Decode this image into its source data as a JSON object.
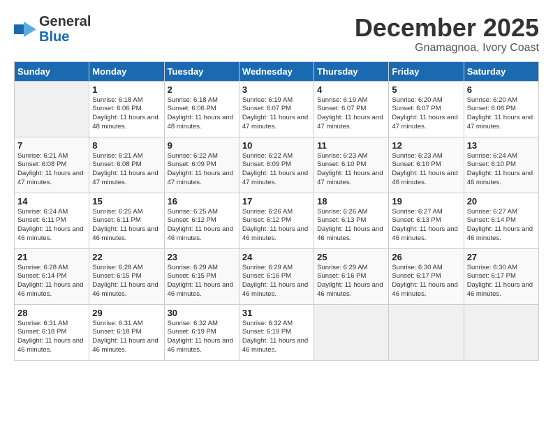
{
  "header": {
    "logo_line1": "General",
    "logo_line2": "Blue",
    "month": "December 2025",
    "location": "Gnamagnoa, Ivory Coast"
  },
  "days_of_week": [
    "Sunday",
    "Monday",
    "Tuesday",
    "Wednesday",
    "Thursday",
    "Friday",
    "Saturday"
  ],
  "weeks": [
    [
      {
        "day": "",
        "sunrise": "",
        "sunset": "",
        "daylight": ""
      },
      {
        "day": "1",
        "sunrise": "Sunrise: 6:18 AM",
        "sunset": "Sunset: 6:06 PM",
        "daylight": "Daylight: 11 hours and 48 minutes."
      },
      {
        "day": "2",
        "sunrise": "Sunrise: 6:18 AM",
        "sunset": "Sunset: 6:06 PM",
        "daylight": "Daylight: 11 hours and 48 minutes."
      },
      {
        "day": "3",
        "sunrise": "Sunrise: 6:19 AM",
        "sunset": "Sunset: 6:07 PM",
        "daylight": "Daylight: 11 hours and 47 minutes."
      },
      {
        "day": "4",
        "sunrise": "Sunrise: 6:19 AM",
        "sunset": "Sunset: 6:07 PM",
        "daylight": "Daylight: 11 hours and 47 minutes."
      },
      {
        "day": "5",
        "sunrise": "Sunrise: 6:20 AM",
        "sunset": "Sunset: 6:07 PM",
        "daylight": "Daylight: 11 hours and 47 minutes."
      },
      {
        "day": "6",
        "sunrise": "Sunrise: 6:20 AM",
        "sunset": "Sunset: 6:08 PM",
        "daylight": "Daylight: 11 hours and 47 minutes."
      }
    ],
    [
      {
        "day": "7",
        "sunrise": "Sunrise: 6:21 AM",
        "sunset": "Sunset: 6:08 PM",
        "daylight": "Daylight: 11 hours and 47 minutes."
      },
      {
        "day": "8",
        "sunrise": "Sunrise: 6:21 AM",
        "sunset": "Sunset: 6:08 PM",
        "daylight": "Daylight: 11 hours and 47 minutes."
      },
      {
        "day": "9",
        "sunrise": "Sunrise: 6:22 AM",
        "sunset": "Sunset: 6:09 PM",
        "daylight": "Daylight: 11 hours and 47 minutes."
      },
      {
        "day": "10",
        "sunrise": "Sunrise: 6:22 AM",
        "sunset": "Sunset: 6:09 PM",
        "daylight": "Daylight: 11 hours and 47 minutes."
      },
      {
        "day": "11",
        "sunrise": "Sunrise: 6:23 AM",
        "sunset": "Sunset: 6:10 PM",
        "daylight": "Daylight: 11 hours and 47 minutes."
      },
      {
        "day": "12",
        "sunrise": "Sunrise: 6:23 AM",
        "sunset": "Sunset: 6:10 PM",
        "daylight": "Daylight: 11 hours and 46 minutes."
      },
      {
        "day": "13",
        "sunrise": "Sunrise: 6:24 AM",
        "sunset": "Sunset: 6:10 PM",
        "daylight": "Daylight: 11 hours and 46 minutes."
      }
    ],
    [
      {
        "day": "14",
        "sunrise": "Sunrise: 6:24 AM",
        "sunset": "Sunset: 6:11 PM",
        "daylight": "Daylight: 11 hours and 46 minutes."
      },
      {
        "day": "15",
        "sunrise": "Sunrise: 6:25 AM",
        "sunset": "Sunset: 6:11 PM",
        "daylight": "Daylight: 11 hours and 46 minutes."
      },
      {
        "day": "16",
        "sunrise": "Sunrise: 6:25 AM",
        "sunset": "Sunset: 6:12 PM",
        "daylight": "Daylight: 11 hours and 46 minutes."
      },
      {
        "day": "17",
        "sunrise": "Sunrise: 6:26 AM",
        "sunset": "Sunset: 6:12 PM",
        "daylight": "Daylight: 11 hours and 46 minutes."
      },
      {
        "day": "18",
        "sunrise": "Sunrise: 6:26 AM",
        "sunset": "Sunset: 6:13 PM",
        "daylight": "Daylight: 11 hours and 46 minutes."
      },
      {
        "day": "19",
        "sunrise": "Sunrise: 6:27 AM",
        "sunset": "Sunset: 6:13 PM",
        "daylight": "Daylight: 11 hours and 46 minutes."
      },
      {
        "day": "20",
        "sunrise": "Sunrise: 6:27 AM",
        "sunset": "Sunset: 6:14 PM",
        "daylight": "Daylight: 11 hours and 46 minutes."
      }
    ],
    [
      {
        "day": "21",
        "sunrise": "Sunrise: 6:28 AM",
        "sunset": "Sunset: 6:14 PM",
        "daylight": "Daylight: 11 hours and 46 minutes."
      },
      {
        "day": "22",
        "sunrise": "Sunrise: 6:28 AM",
        "sunset": "Sunset: 6:15 PM",
        "daylight": "Daylight: 11 hours and 46 minutes."
      },
      {
        "day": "23",
        "sunrise": "Sunrise: 6:29 AM",
        "sunset": "Sunset: 6:15 PM",
        "daylight": "Daylight: 11 hours and 46 minutes."
      },
      {
        "day": "24",
        "sunrise": "Sunrise: 6:29 AM",
        "sunset": "Sunset: 6:16 PM",
        "daylight": "Daylight: 11 hours and 46 minutes."
      },
      {
        "day": "25",
        "sunrise": "Sunrise: 6:29 AM",
        "sunset": "Sunset: 6:16 PM",
        "daylight": "Daylight: 11 hours and 46 minutes."
      },
      {
        "day": "26",
        "sunrise": "Sunrise: 6:30 AM",
        "sunset": "Sunset: 6:17 PM",
        "daylight": "Daylight: 11 hours and 46 minutes."
      },
      {
        "day": "27",
        "sunrise": "Sunrise: 6:30 AM",
        "sunset": "Sunset: 6:17 PM",
        "daylight": "Daylight: 11 hours and 46 minutes."
      }
    ],
    [
      {
        "day": "28",
        "sunrise": "Sunrise: 6:31 AM",
        "sunset": "Sunset: 6:18 PM",
        "daylight": "Daylight: 11 hours and 46 minutes."
      },
      {
        "day": "29",
        "sunrise": "Sunrise: 6:31 AM",
        "sunset": "Sunset: 6:18 PM",
        "daylight": "Daylight: 11 hours and 46 minutes."
      },
      {
        "day": "30",
        "sunrise": "Sunrise: 6:32 AM",
        "sunset": "Sunset: 6:19 PM",
        "daylight": "Daylight: 11 hours and 46 minutes."
      },
      {
        "day": "31",
        "sunrise": "Sunrise: 6:32 AM",
        "sunset": "Sunset: 6:19 PM",
        "daylight": "Daylight: 11 hours and 46 minutes."
      },
      {
        "day": "",
        "sunrise": "",
        "sunset": "",
        "daylight": ""
      },
      {
        "day": "",
        "sunrise": "",
        "sunset": "",
        "daylight": ""
      },
      {
        "day": "",
        "sunrise": "",
        "sunset": "",
        "daylight": ""
      }
    ]
  ]
}
